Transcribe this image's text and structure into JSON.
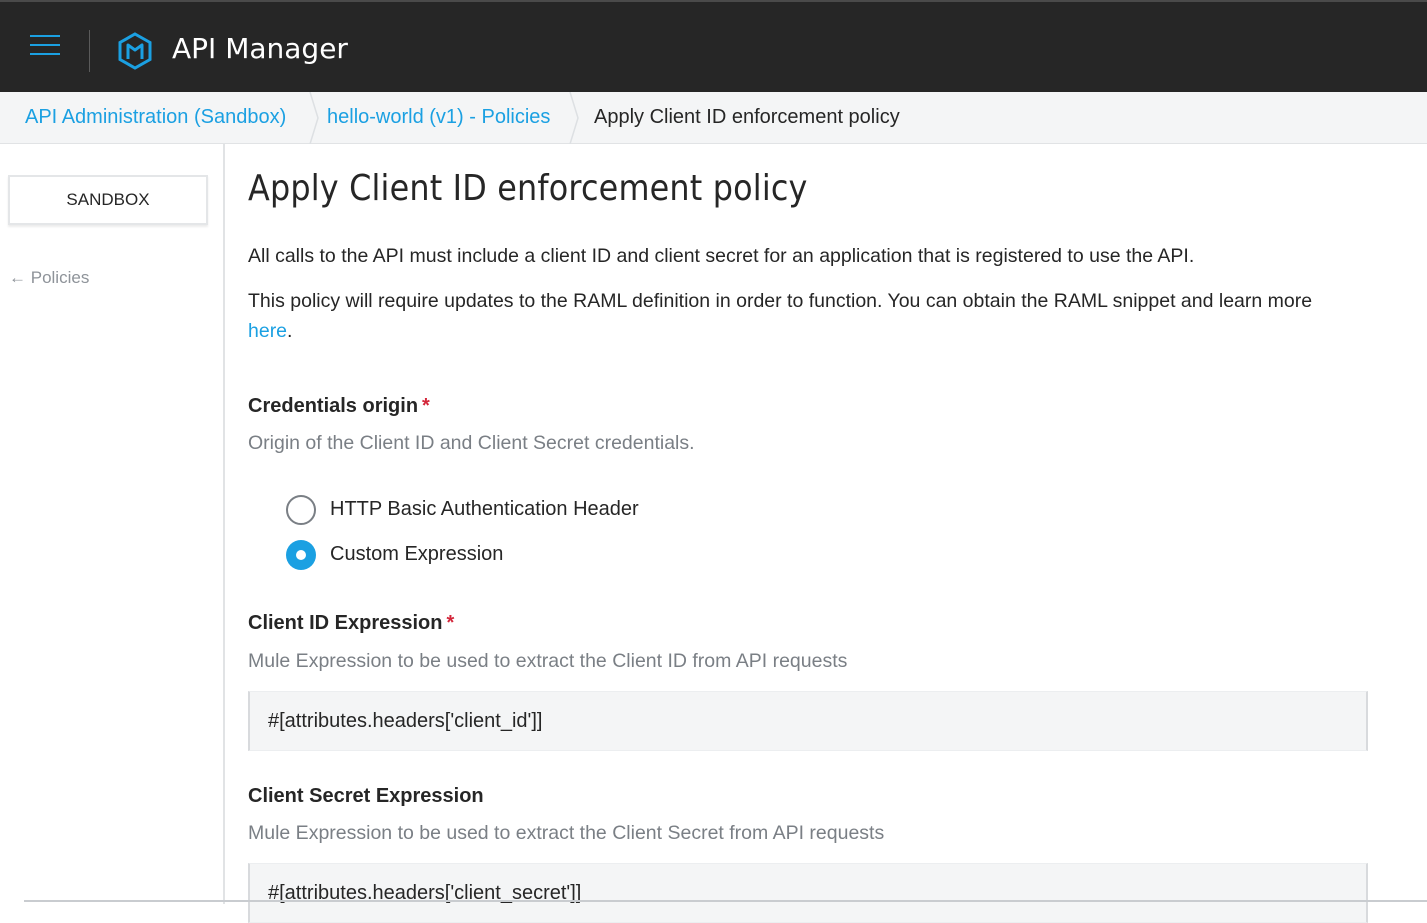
{
  "header": {
    "app_title": "API Manager",
    "menu_icon": "hamburger-menu-icon",
    "logo_icon": "mulesoft-logo-icon",
    "accent_color": "#1ba0e2",
    "background_color": "#262626"
  },
  "breadcrumb": {
    "items": [
      {
        "label": "API Administration (Sandbox)"
      },
      {
        "label": "hello-world (v1) - Policies"
      },
      {
        "label": "Apply Client ID enforcement policy"
      }
    ]
  },
  "sidebar": {
    "environment_label": "SANDBOX",
    "back_label": "Policies",
    "back_icon": "arrow-left-icon"
  },
  "main": {
    "title": "Apply Client ID enforcement policy",
    "description": "All calls to the API must include a client ID and client secret for an application that is registered to use the API.",
    "raml_note": "This policy will require updates to the RAML definition in order to function. You can obtain the RAML snippet and learn more",
    "raml_link": "here",
    "raml_suffix": ".",
    "credentials_origin": {
      "label": "Credentials origin",
      "required_mark": "*",
      "help": "Origin of the Client ID and Client Secret credentials.",
      "options": [
        {
          "label": "HTTP Basic Authentication Header",
          "checked": false
        },
        {
          "label": "Custom Expression",
          "checked": true
        }
      ]
    },
    "client_id_expression": {
      "label": "Client ID Expression",
      "required_mark": "*",
      "help": "Mule Expression to be used to extract the Client ID from API requests",
      "value": "#[attributes.headers['client_id']]"
    },
    "client_secret_expression": {
      "label": "Client Secret Expression",
      "help": "Mule Expression to be used to extract the Client Secret from API requests",
      "value": "#[attributes.headers['client_secret']]"
    }
  }
}
